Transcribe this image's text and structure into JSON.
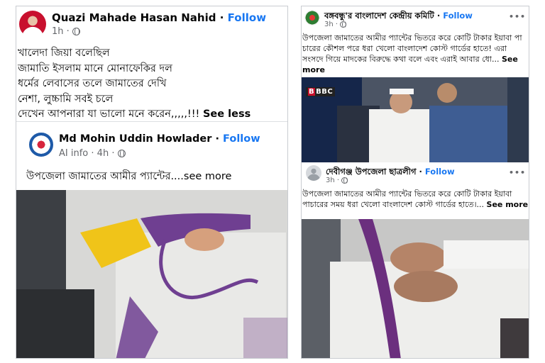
{
  "left_post": {
    "author": "Quazi Mahade Hasan Nahid",
    "follow": "Follow",
    "time": "1h",
    "dot": "·",
    "lines": [
      "খালেদা জিয়া বলেছিল",
      "জামাতি ইসলাম মানে মোনাফেকির দল",
      "ধর্মের লেবাসের তলে জামাতের দেখি",
      "নেশা, লুচ্চামি সবই চলে",
      "দেখেন আপনারা যা ভালো মনে করেন,,,,,!!!"
    ],
    "see_less": "See less",
    "shared": {
      "author": "Md Mohin Uddin Howlader",
      "follow": "Follow",
      "info": "AI info",
      "time": "4h",
      "dot": "·",
      "text": "উপজেলা জামাতের আমীর প্যান্টের....",
      "see_more": "see more"
    }
  },
  "right_post": {
    "author": "বঙ্গবন্ধু'র বাংলাদেশ কেন্দ্রীয় কমিটি",
    "follow": "Follow",
    "time": "3h",
    "dot": "·",
    "more": "•••",
    "lines": [
      "উপজেলা জামাতের আমীর প্যান্টের ভিতরে করে কোটি টাকার ইয়াবা পা",
      "চারের কৌশল পরে ধরা খেলো বাংলাদেশ কোস্ট গার্ডের হাতে! এরা",
      "সংসদে গিয়ে মাদকের বিরুদ্ধে কথা বলে এবং এরাই আবার ধো...",
      "more"
    ],
    "see": "See",
    "badge": "BBC",
    "badge_b": "B",
    "second": {
      "author": "দেবীগঞ্জ উপজেলা ছাত্রলীগ",
      "follow": "Follow",
      "time": "3h",
      "dot": "·",
      "more": "•••",
      "lines": [
        "উপজেলা জামাতের আমীর প্যান্টের ভিতরে করে কোটি টাকার ইয়াবা",
        "পাচারের সময় ধরা খেলো বাংলাদেশ কোস্ট গার্ডের হাতে।..."
      ],
      "see_more": "See more"
    }
  },
  "colors": {
    "link": "#1877f2",
    "meta": "#65676b",
    "border": "#c9ccd1"
  }
}
